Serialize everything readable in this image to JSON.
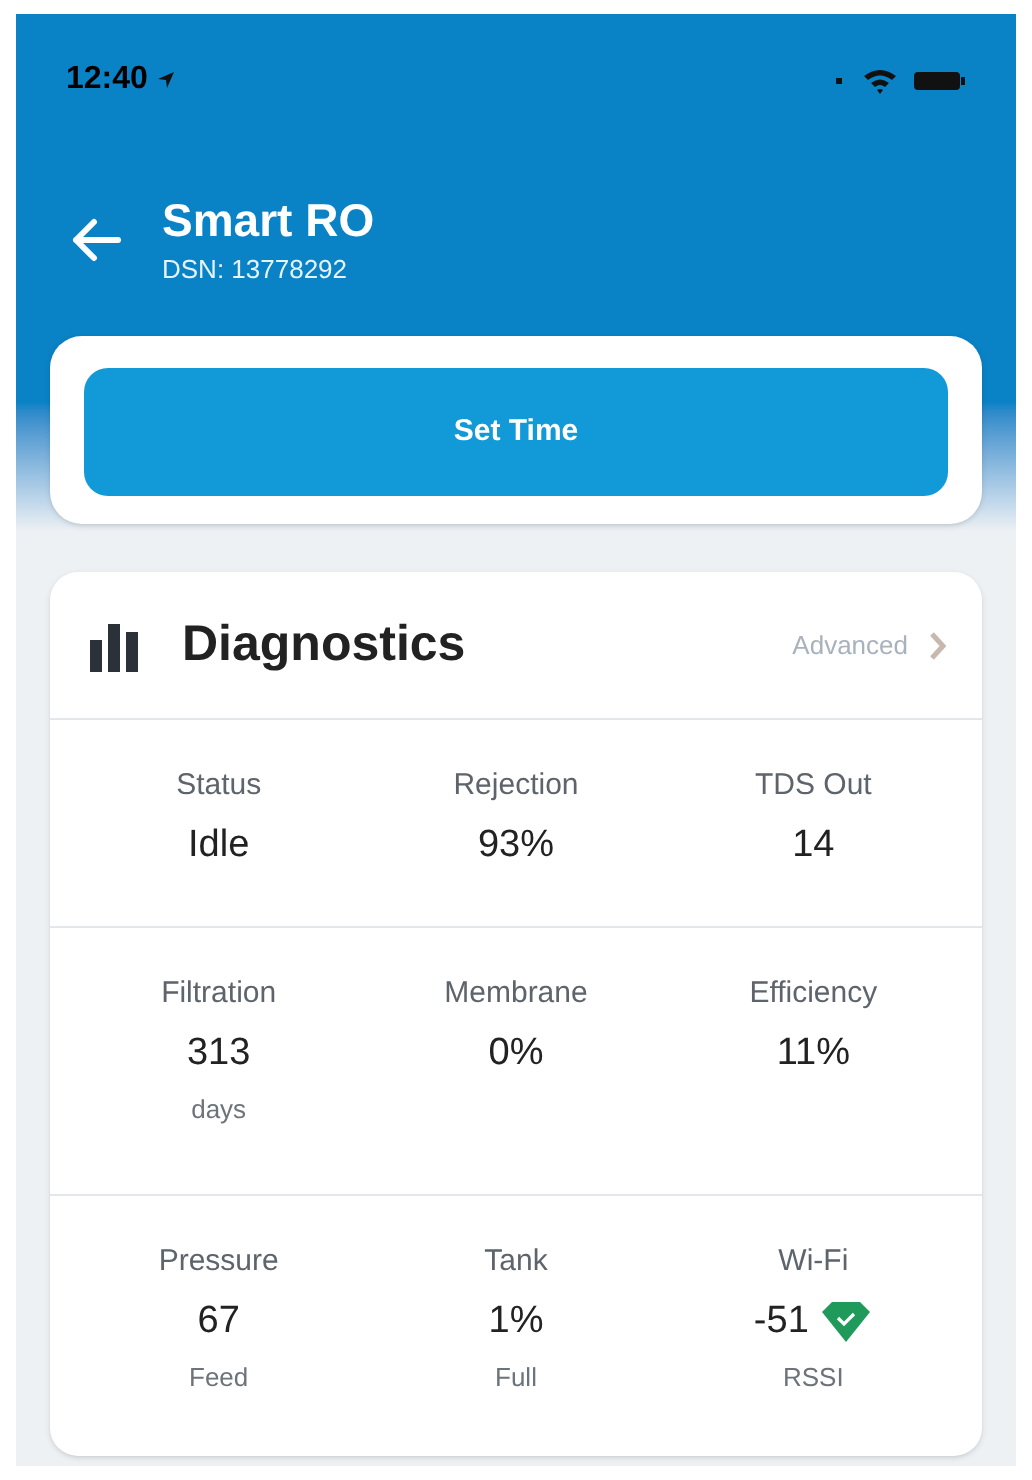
{
  "status_bar": {
    "time": "12:40"
  },
  "header": {
    "title": "Smart RO",
    "subtitle": "DSN: 13778292"
  },
  "set_time_button": {
    "label": "Set Time"
  },
  "diagnostics": {
    "title": "Diagnostics",
    "advanced_link": "Advanced",
    "rows": [
      [
        {
          "kind": "plain",
          "label": "Status",
          "value": "Idle"
        },
        {
          "kind": "plain",
          "label": "Rejection",
          "value": "93%"
        },
        {
          "kind": "plain",
          "label": "TDS Out",
          "value": "14"
        }
      ],
      [
        {
          "kind": "plain",
          "label": "Filtration",
          "value": "313",
          "unit": "days"
        },
        {
          "kind": "plain",
          "label": "Membrane",
          "value": "0%"
        },
        {
          "kind": "plain",
          "label": "Efficiency",
          "value": "11%"
        }
      ],
      [
        {
          "kind": "plain",
          "label": "Pressure",
          "value": "67",
          "unit": "Feed"
        },
        {
          "kind": "plain",
          "label": "Tank",
          "value": "1%",
          "unit": "Full"
        },
        {
          "kind": "signal",
          "label": "Wi-Fi",
          "value": "-51",
          "unit": "RSSI"
        }
      ]
    ]
  }
}
